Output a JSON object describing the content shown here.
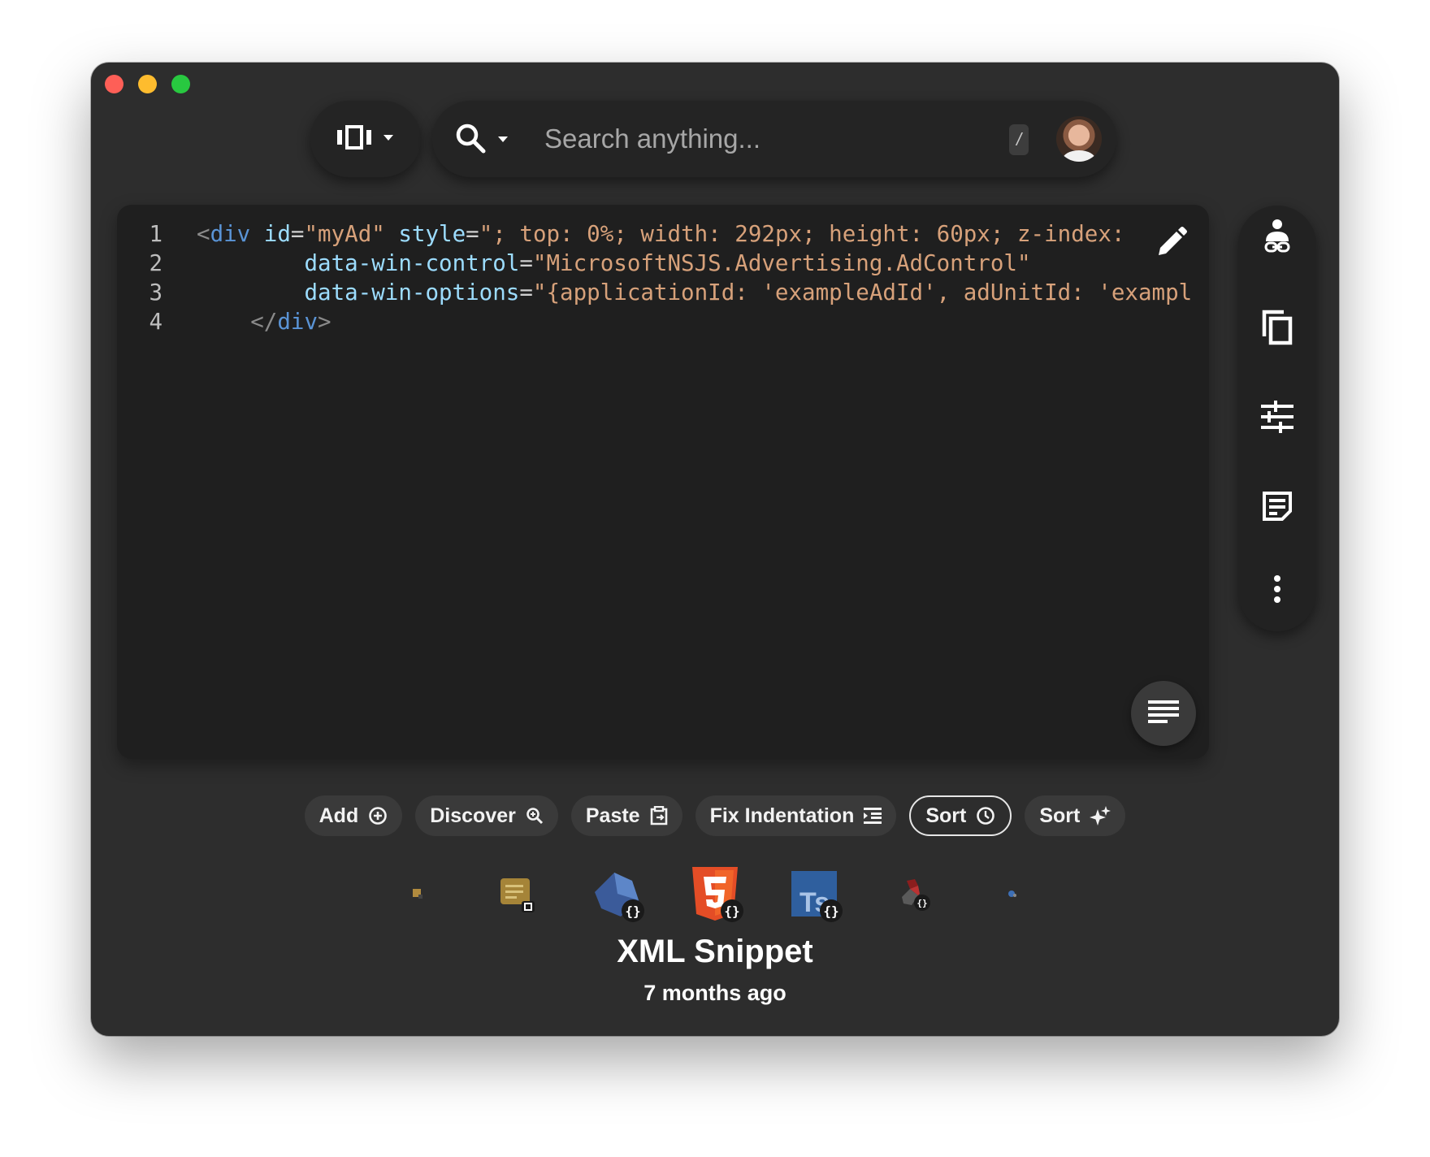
{
  "window": {
    "traffic_lights": [
      "close",
      "minimize",
      "maximize"
    ]
  },
  "toolbar": {
    "view_icon": "carousel-view-icon",
    "search_placeholder": "Search anything...",
    "shortcut_key": "/",
    "avatar": "user-avatar"
  },
  "editor": {
    "lines": [
      {
        "number": "1",
        "indent": "",
        "tag_open": "<",
        "tag": "div",
        "segments": [
          {
            "kind": "attr",
            "text": " id"
          },
          {
            "kind": "eq",
            "text": "="
          },
          {
            "kind": "str",
            "text": "\"myAd\""
          },
          {
            "kind": "attr",
            "text": " style"
          },
          {
            "kind": "eq",
            "text": "="
          },
          {
            "kind": "str",
            "text": "\"; top: 0%; width: 292px; height: 60px; z-index:"
          }
        ]
      },
      {
        "number": "2",
        "indent": "        ",
        "segments": [
          {
            "kind": "attr",
            "text": "data-win-control"
          },
          {
            "kind": "eq",
            "text": "="
          },
          {
            "kind": "str",
            "text": "\"MicrosoftNSJS.Advertising.AdControl\""
          }
        ]
      },
      {
        "number": "3",
        "indent": "        ",
        "segments": [
          {
            "kind": "attr",
            "text": "data-win-options"
          },
          {
            "kind": "eq",
            "text": "="
          },
          {
            "kind": "str",
            "text": "\"{applicationId: 'exampleAdId', adUnitId: 'exampl"
          }
        ]
      },
      {
        "number": "4",
        "indent": "    ",
        "closing": "</div>"
      }
    ],
    "closing_open": "</",
    "closing_tag": "div",
    "closing_close": ">",
    "edit_icon": "pencil-icon",
    "format_icon": "format-lines-icon"
  },
  "rail": {
    "items": [
      "share-user-link-icon",
      "copy-icon",
      "tune-sliders-icon",
      "notes-icon",
      "more-vertical-icon"
    ]
  },
  "actions": [
    {
      "label": "Add",
      "icon": "add-circle-icon"
    },
    {
      "label": "Discover",
      "icon": "search-zoom-icon"
    },
    {
      "label": "Paste",
      "icon": "paste-clipboard-icon"
    },
    {
      "label": "Fix Indentation",
      "icon": "indent-icon"
    },
    {
      "label": "Sort",
      "icon": "clock-icon",
      "selected": true
    },
    {
      "label": "Sort",
      "icon": "sparkles-icon"
    }
  ],
  "apps": [
    {
      "name": "tiny-app-icon"
    },
    {
      "name": "notes-app-icon"
    },
    {
      "name": "dart-icon",
      "badge": "{}"
    },
    {
      "name": "html5-icon",
      "badge": "{}"
    },
    {
      "name": "typescript-icon",
      "badge": "{}"
    },
    {
      "name": "ruby-icon",
      "badge": "{}"
    },
    {
      "name": "small-blue-icon"
    }
  ],
  "snippet": {
    "title": "XML Snippet",
    "time": "7 months ago"
  },
  "colors": {
    "window_bg": "#2d2d2d",
    "editor_bg": "#1f1f1f",
    "tag": "#5a94d6",
    "attr": "#9cdcfe",
    "string": "#d7a17a"
  }
}
